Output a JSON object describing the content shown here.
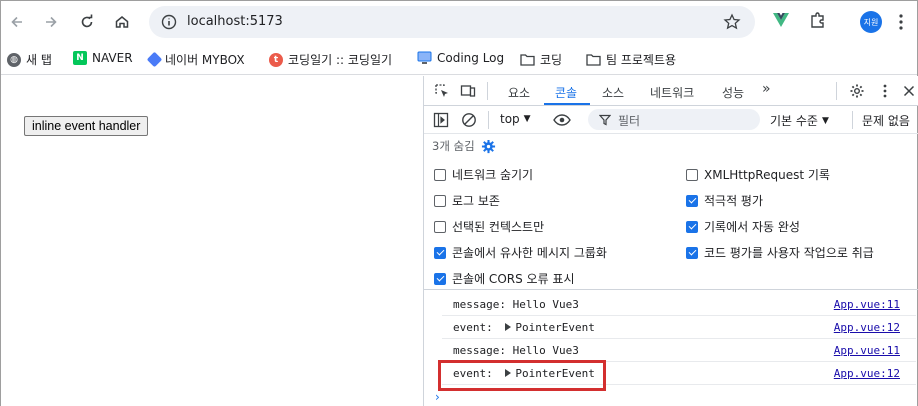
{
  "browser": {
    "url": "localhost:5173",
    "profile_initials": "지원",
    "bookmarks": [
      {
        "label": "새 탭",
        "icon": "globe-icon"
      },
      {
        "label": "NAVER",
        "icon": "naver-icon"
      },
      {
        "label": "네이버 MYBOX",
        "icon": "mybox-icon"
      },
      {
        "label": "코딩일기 :: 코딩일기",
        "icon": "tistory-icon"
      },
      {
        "label": "Coding Log",
        "icon": "monitor-icon"
      },
      {
        "label": "코딩",
        "icon": "folder-icon"
      },
      {
        "label": "팀 프로젝트용",
        "icon": "folder-icon"
      }
    ]
  },
  "page": {
    "button_label": "inline event handler"
  },
  "devtools": {
    "tabs": [
      "요소",
      "콘솔",
      "소스",
      "네트워크",
      "성능"
    ],
    "active_tab": "콘솔",
    "context": "top",
    "filter_placeholder": "필터",
    "level": "기본 수준",
    "issues": "문제 없음",
    "hidden_count": "3개 숨김",
    "settings": [
      {
        "label": "네트워크 숨기기",
        "checked": false
      },
      {
        "label": "XMLHttpRequest 기록",
        "checked": false
      },
      {
        "label": "로그 보존",
        "checked": false
      },
      {
        "label": "적극적 평가",
        "checked": true
      },
      {
        "label": "선택된 컨텍스트만",
        "checked": false
      },
      {
        "label": "기록에서 자동 완성",
        "checked": true
      },
      {
        "label": "콘솔에서 유사한 메시지 그룹화",
        "checked": true
      },
      {
        "label": "코드 평가를 사용자 작업으로 취급",
        "checked": true
      },
      {
        "label": "콘솔에 CORS 오류 표시",
        "checked": true
      }
    ],
    "logs": [
      {
        "prefix": "message:",
        "value": "Hello Vue3",
        "expandable": false,
        "source": "App.vue:11"
      },
      {
        "prefix": "event:",
        "value": "PointerEvent",
        "expandable": true,
        "source": "App.vue:12"
      },
      {
        "prefix": "message:",
        "value": "Hello Vue3",
        "expandable": false,
        "source": "App.vue:11"
      },
      {
        "prefix": "event:",
        "value": "PointerEvent",
        "expandable": true,
        "source": "App.vue:12"
      }
    ],
    "prompt": "›",
    "colors": {
      "accent": "#1a73e8",
      "highlight": "#d32f2f"
    }
  }
}
